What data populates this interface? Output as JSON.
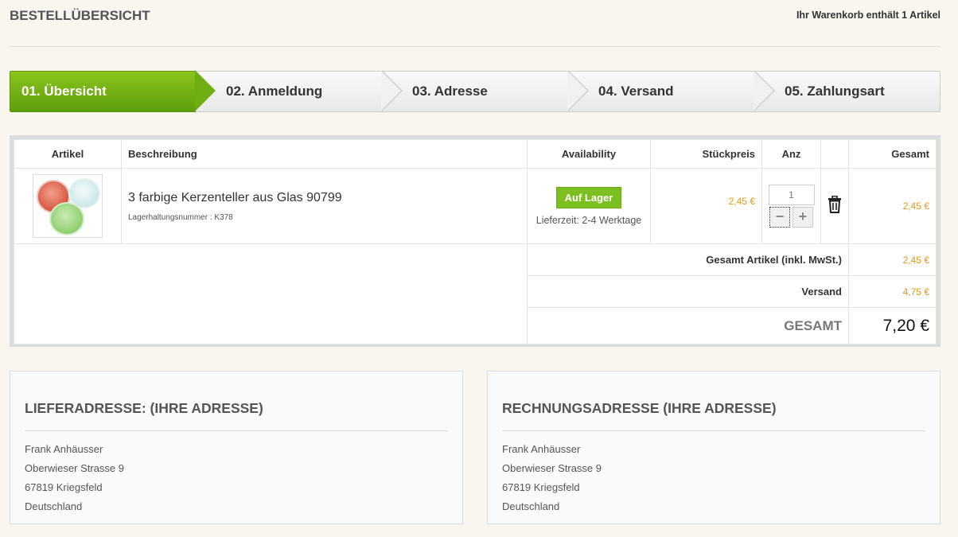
{
  "header": {
    "title": "BESTELLÜBERSICHT",
    "cart_count": "Ihr Warenkorb enthält 1 Artikel"
  },
  "steps": [
    {
      "label": "01. Übersicht",
      "active": true
    },
    {
      "label": "02. Anmeldung",
      "active": false
    },
    {
      "label": "03. Adresse",
      "active": false
    },
    {
      "label": "04. Versand",
      "active": false
    },
    {
      "label": "05. Zahlungsart",
      "active": false
    }
  ],
  "cart": {
    "columns": {
      "article": "Artikel",
      "description": "Beschreibung",
      "availability": "Availability",
      "unit_price": "Stückpreis",
      "quantity": "Anz",
      "total": "Gesamt"
    },
    "items": [
      {
        "name": "3 farbige Kerzenteller aus Glas 90799",
        "sku": "Lagerhaltungsnummer : K378",
        "availability": "Auf Lager",
        "delivery": "Lieferzeit: 2-4 Werktage",
        "unit_price": "2,45 €",
        "quantity": "1",
        "total": "2,45 €"
      }
    ],
    "summary": {
      "subtotal_label": "Gesamt Artikel (inkl. MwSt.)",
      "subtotal": "2,45 €",
      "shipping_label": "Versand",
      "shipping": "4,75 €",
      "grand_label": "GESAMT",
      "grand_total": "7,20 €"
    }
  },
  "shipping_address": {
    "title": "LIEFERADRESSE: (IHRE ADRESSE)",
    "name": "Frank Anhäusser",
    "street": "Oberwieser Strasse 9",
    "city": "67819 Kriegsfeld",
    "country": "Deutschland"
  },
  "billing_address": {
    "title": "RECHNUNGSADRESSE (IHRE ADRESSE)",
    "name": "Frank Anhäusser",
    "street": "Oberwieser Strasse 9",
    "city": "67819 Kriegsfeld",
    "country": "Deutschland"
  },
  "colors": {
    "accent_green": "#7cc01f",
    "price_orange": "#e69a1a",
    "background": "#f9f6ef"
  },
  "icons": {
    "delete": "trash-icon",
    "decrease": "minus-icon",
    "increase": "plus-icon"
  }
}
